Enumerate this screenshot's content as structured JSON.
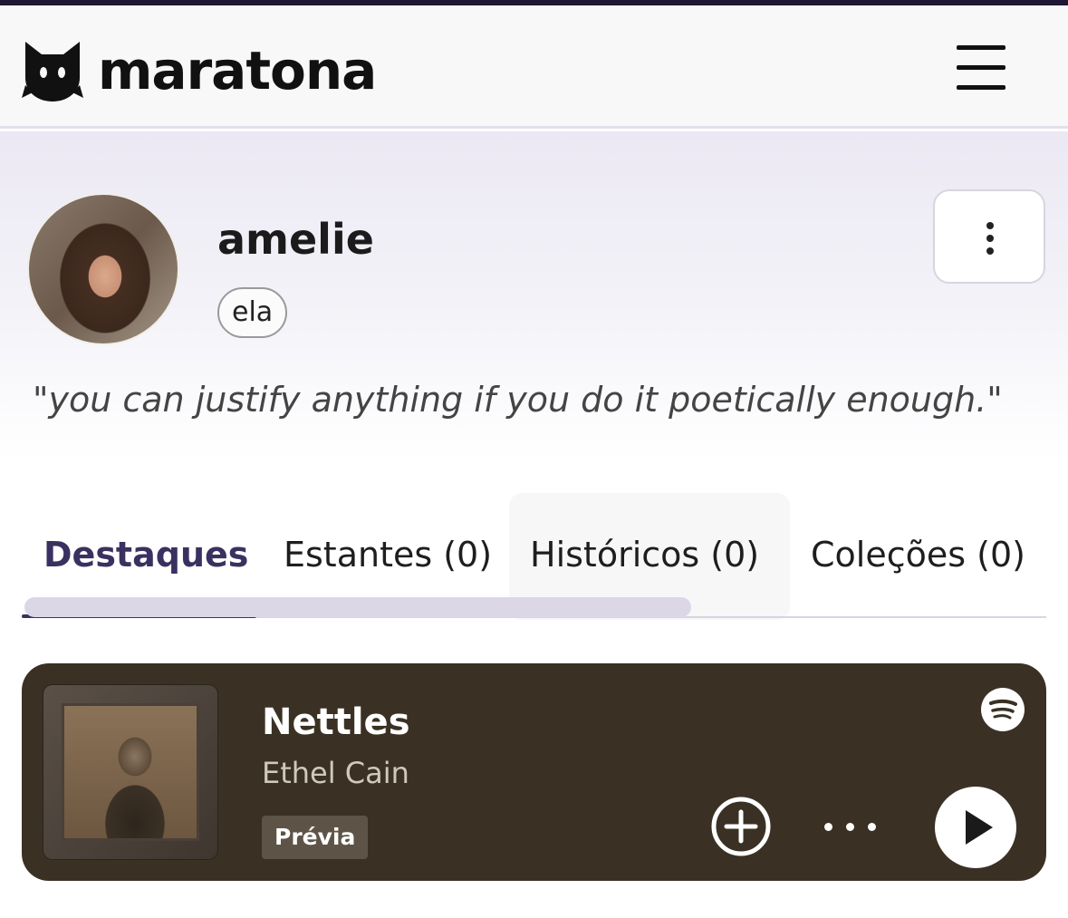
{
  "header": {
    "logo_text": "maratona",
    "icons": {
      "logo": "cat-logo-icon",
      "menu": "hamburger-menu-icon"
    }
  },
  "profile": {
    "username": "amelie",
    "pronoun": "ela",
    "bio": "\"you can justify anything if you do it poetically enough.\"",
    "icons": {
      "options": "kebab-menu-icon"
    }
  },
  "tabs": [
    {
      "label": "Destaques",
      "active": true
    },
    {
      "label": "Estantes (0)",
      "active": false
    },
    {
      "label": "Históricos (0)",
      "active": false
    },
    {
      "label": "Coleções (0)",
      "active": false
    }
  ],
  "track": {
    "title": "Nettles",
    "artist": "Ethel Cain",
    "badge": "Prévia",
    "icons": {
      "source": "spotify-icon",
      "add": "plus-circle-icon",
      "more": "ellipsis-icon",
      "play": "play-icon"
    }
  },
  "colors": {
    "brand_dark": "#1e1633",
    "accent": "#3b3160",
    "card_bg": "#3a3124"
  }
}
